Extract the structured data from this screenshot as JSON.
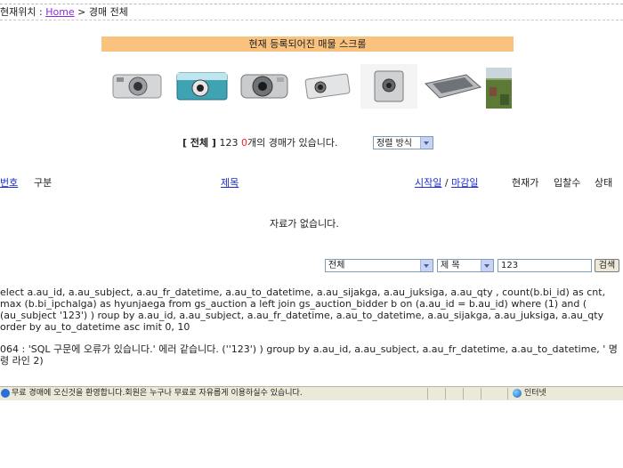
{
  "breadcrumb": {
    "label": "현재위치 : ",
    "home": "Home",
    "separator": " > ",
    "current": "경매 전체"
  },
  "banner": {
    "title": "현재 등록되어진 매물 스크롤"
  },
  "thumbnails": [
    {
      "icon": "camera-silver-icon"
    },
    {
      "icon": "camera-teal-icon"
    },
    {
      "icon": "camera-compact-icon"
    },
    {
      "icon": "camera-slim-icon"
    },
    {
      "icon": "camera-mini-icon"
    },
    {
      "icon": "scanner-icon"
    },
    {
      "icon": "photo-landscape-icon"
    }
  ],
  "summary": {
    "prefix": "[ 전체 ]",
    "keyword": "123",
    "count": "0",
    "suffix": "개의 경매가 있습니다."
  },
  "sort": {
    "value": "정렬 방식"
  },
  "columns": {
    "number": "번호",
    "category": "구분",
    "title": "제목",
    "start": "시작일",
    "slash": "/",
    "end": "마감일",
    "current_price": "현재가",
    "bids": "입찰수",
    "status": "상태"
  },
  "empty_message": "자료가 없습니다.",
  "search": {
    "scope": "전체",
    "field": "제 목",
    "query": "123",
    "button": "검색"
  },
  "sql_text": "elect a.au_id, a.au_subject, a.au_fr_datetime, a.au_to_datetime, a.au_sijakga, a.au_juksiga, a.au_qty , count(b.bi_id) as cnt, max (b.bi_ipchalga) as hyunjaega from gs_auction a left join gs_auction_bidder b on (a.au_id = b.au_id) where (1) and ( (au_subject '123') ) roup by a.au_id, a.au_subject, a.au_fr_datetime, a.au_to_datetime, a.au_sijakga, a.au_juksiga, a.au_qty order by au_to_datetime asc imit 0, 10",
  "error_text": "064 : 'SQL 구문에 오류가 있습니다.' 에러 같습니다. (''123') ) group by a.au_id, a.au_subject, a.au_fr_datetime, a.au_to_datetime, ' 명령 라인 2)",
  "statusbar": {
    "message": "무료 경매에 오신것을 환영합니다.회원은 누구나 무료로 자유롭게 이용하실수 있습니다.",
    "zone": "인터넷"
  }
}
